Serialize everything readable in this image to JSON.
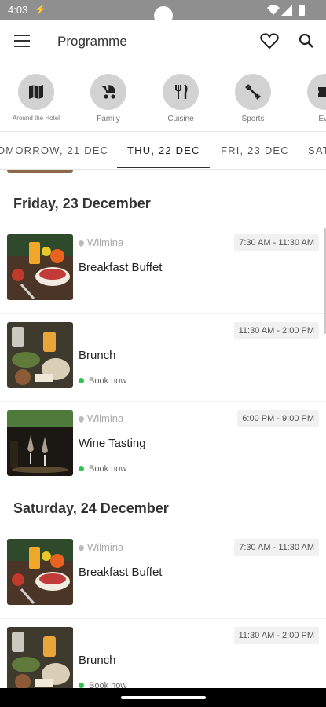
{
  "status": {
    "time": "4:03",
    "alert_icon": "alert-icon"
  },
  "appbar": {
    "title": "Programme",
    "menu_icon": "menu-icon",
    "favorite_icon": "heart-icon",
    "search_icon": "search-icon"
  },
  "categories": [
    {
      "label": "Around the Hotel",
      "icon": "map-icon"
    },
    {
      "label": "Family",
      "icon": "stroller-icon"
    },
    {
      "label": "Cuisine",
      "icon": "cutlery-icon"
    },
    {
      "label": "Sports",
      "icon": "dumbbell-icon"
    },
    {
      "label": "Eve",
      "icon": "ticket-icon"
    }
  ],
  "tabs": [
    {
      "label": "OMORROW, 21 DEC"
    },
    {
      "label": "THU, 22 DEC"
    },
    {
      "label": "FRI, 23 DEC"
    },
    {
      "label": "SAT"
    }
  ],
  "active_tab_index": 1,
  "sections": [
    {
      "title": "Friday, 23 December",
      "events": [
        {
          "location": "Wilmina",
          "time": "7:30 AM - 11:30 AM",
          "name": "Breakfast Buffet",
          "book": ""
        },
        {
          "location": "",
          "time": "11:30 AM - 2:00 PM",
          "name": "Brunch",
          "book": "Book now"
        },
        {
          "location": "Wilmina",
          "time": "6:00 PM - 9:00 PM",
          "name": "Wine Tasting",
          "book": "Book now"
        }
      ]
    },
    {
      "title": "Saturday, 24 December",
      "events": [
        {
          "location": "Wilmina",
          "time": "7:30 AM - 11:30 AM",
          "name": "Breakfast Buffet",
          "book": ""
        },
        {
          "location": "",
          "time": "11:30 AM - 2:00 PM",
          "name": "Brunch",
          "book": "Book now"
        }
      ]
    }
  ],
  "colors": {
    "book_dot": "#2fc452",
    "status_bar": "#8f8f8f",
    "category_circle": "#d2d2d2"
  }
}
